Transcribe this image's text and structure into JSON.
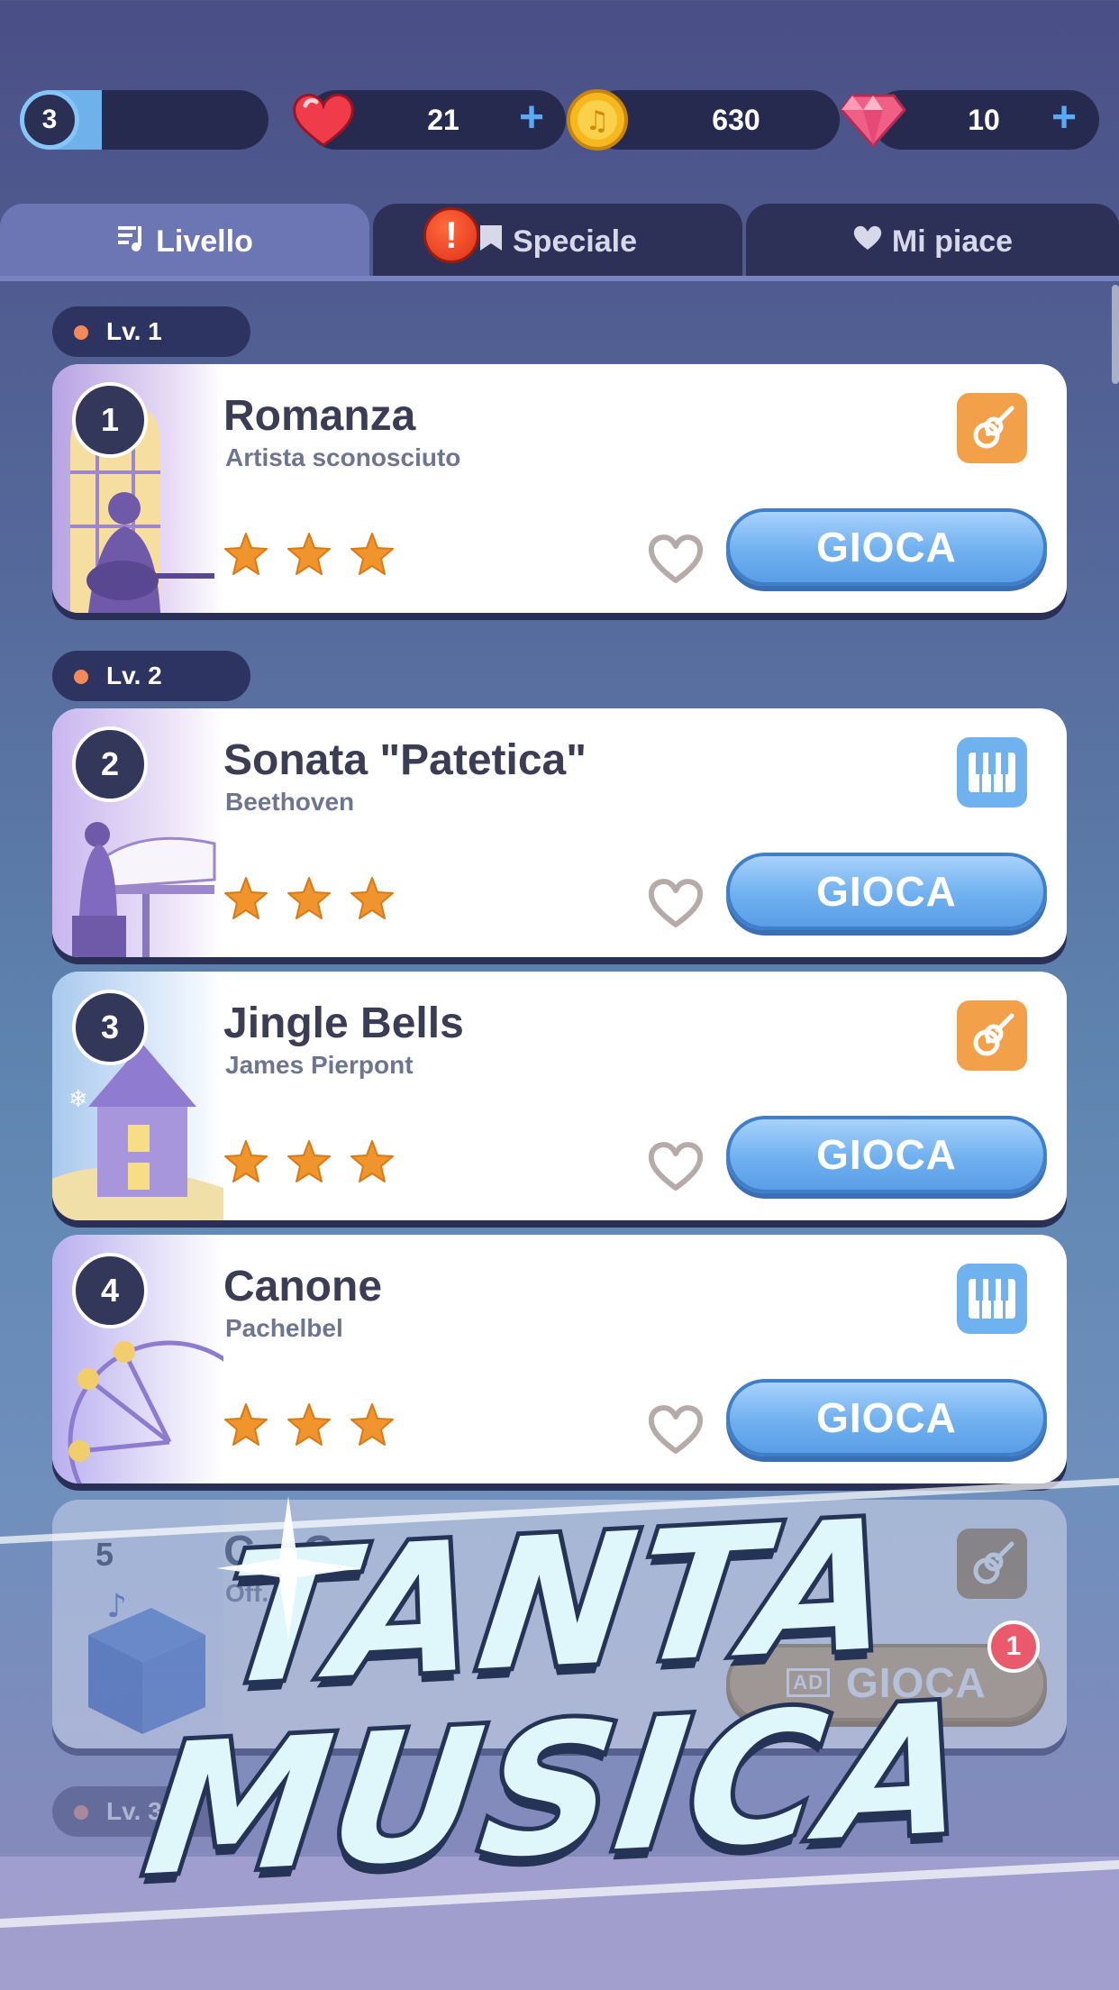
{
  "topbar": {
    "player_level": "3",
    "level_progress": 0.33,
    "lives": "21",
    "coins": "630",
    "gems": "10",
    "plus_symbol": "+"
  },
  "tabs": [
    {
      "label": "Livello",
      "icon": "music-list-icon",
      "active": true
    },
    {
      "label": "Speciale",
      "icon": "bookmark-icon",
      "alert": "!"
    },
    {
      "label": "Mi piace",
      "icon": "heart-icon"
    }
  ],
  "levels": [
    {
      "label": "Lv. 1"
    },
    {
      "label": "Lv. 2"
    },
    {
      "label": "Lv. 3"
    }
  ],
  "songs": [
    {
      "number": "1",
      "title": "Romanza",
      "artist": "Artista sconosciuto",
      "stars": 3,
      "instrument": "guitar-icon",
      "play_label": "GIOCA"
    },
    {
      "number": "2",
      "title": "Sonata \"Patetica\"",
      "artist": "Beethoven",
      "stars": 3,
      "instrument": "piano-icon",
      "play_label": "GIOCA"
    },
    {
      "number": "3",
      "title": "Jingle Bells",
      "artist": "James Pierpont",
      "stars": 3,
      "instrument": "guitar-icon",
      "play_label": "GIOCA"
    },
    {
      "number": "4",
      "title": "Canone",
      "artist": "Pachelbel",
      "stars": 3,
      "instrument": "piano-icon",
      "play_label": "GIOCA"
    },
    {
      "number": "5",
      "title": "C... C...",
      "artist": "Off...",
      "stars": 0,
      "instrument": "guitar-icon",
      "play_label": "GIOCA",
      "ad_label": "AD",
      "badge": "1"
    }
  ],
  "banner": {
    "line1": "TANTA",
    "line2": "MUSICA"
  },
  "colors": {
    "accent": "#6fb0f0",
    "star": "#f0952e",
    "background": "#566a9c"
  }
}
